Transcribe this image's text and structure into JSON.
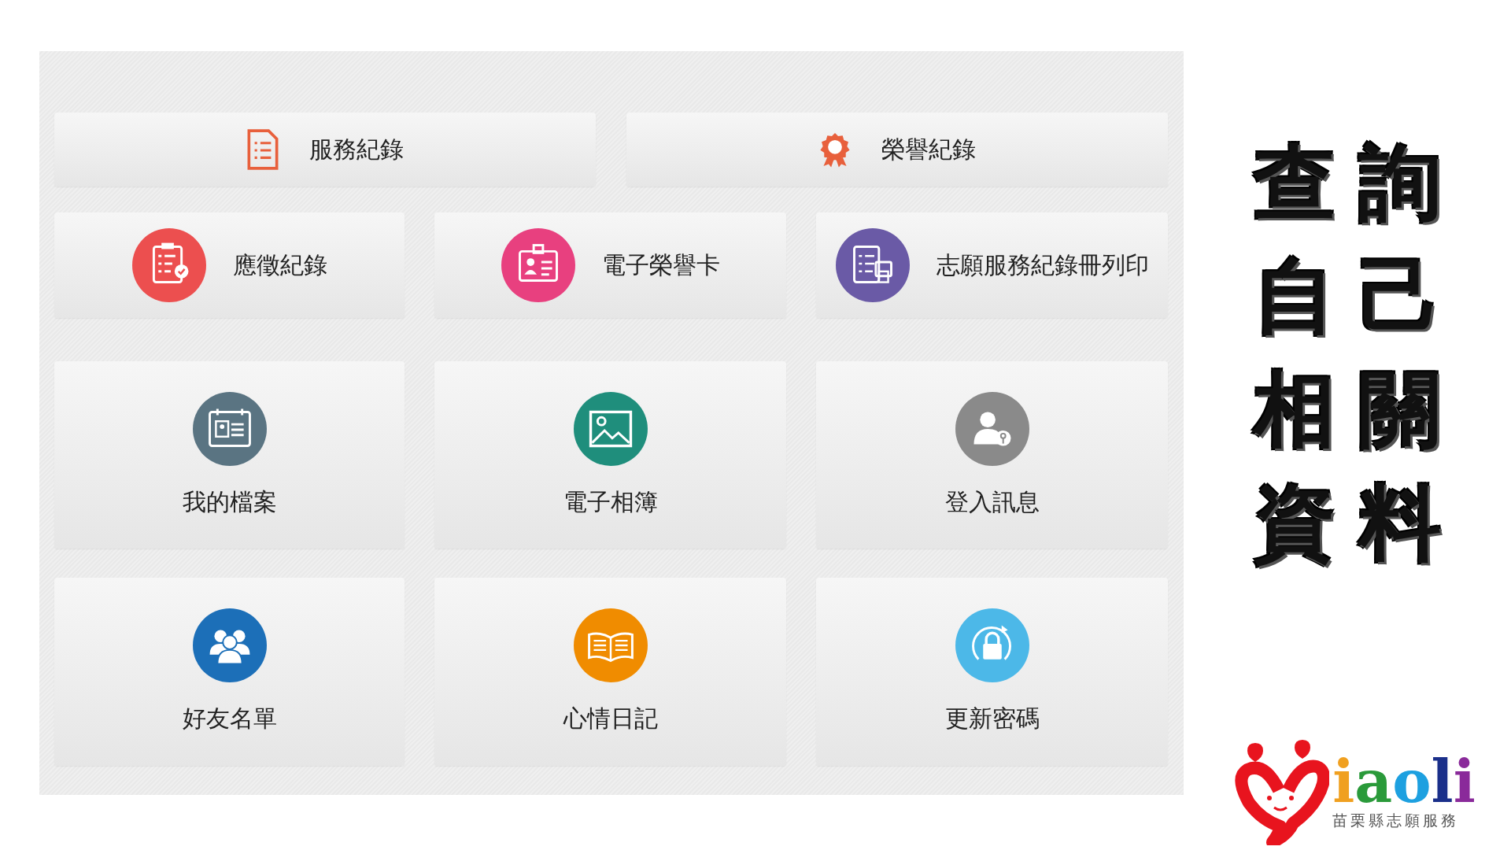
{
  "top_buttons": [
    {
      "label": "服務紀錄"
    },
    {
      "label": "榮譽紀錄"
    }
  ],
  "rows": [
    [
      {
        "label": "應徵紀錄",
        "color": "#ec4f4f"
      },
      {
        "label": "電子榮譽卡",
        "color": "#e8407f"
      },
      {
        "label": "志願服務紀錄冊列印",
        "color": "#6a5aa6"
      }
    ],
    [
      {
        "label": "我的檔案",
        "color": "#5a7482"
      },
      {
        "label": "電子相簿",
        "color": "#1f8e7c"
      },
      {
        "label": "登入訊息",
        "color": "#8a8a8a"
      }
    ],
    [
      {
        "label": "好友名單",
        "color": "#1c6fb8"
      },
      {
        "label": "心情日記",
        "color": "#f08c00"
      },
      {
        "label": "更新密碼",
        "color": "#4cb8e8"
      }
    ]
  ],
  "caption": [
    "查詢",
    "自己",
    "相關",
    "資料"
  ],
  "logo": {
    "wordmark": "iaoli",
    "subtitle": "苗栗縣志願服務"
  }
}
